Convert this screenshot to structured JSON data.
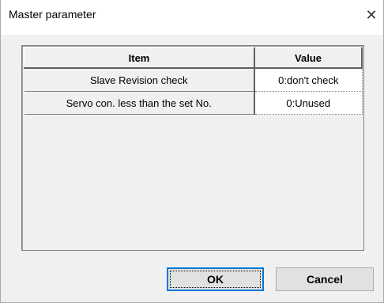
{
  "window": {
    "title": "Master parameter",
    "close_glyph": "✕"
  },
  "grid": {
    "headers": {
      "item": "Item",
      "value": "Value"
    },
    "rows": [
      {
        "item": "Slave Revision check",
        "value": "0:don't check"
      },
      {
        "item": "Servo con. less than the set No.",
        "value": "0:Unused"
      }
    ]
  },
  "buttons": {
    "ok": "OK",
    "cancel": "Cancel"
  }
}
